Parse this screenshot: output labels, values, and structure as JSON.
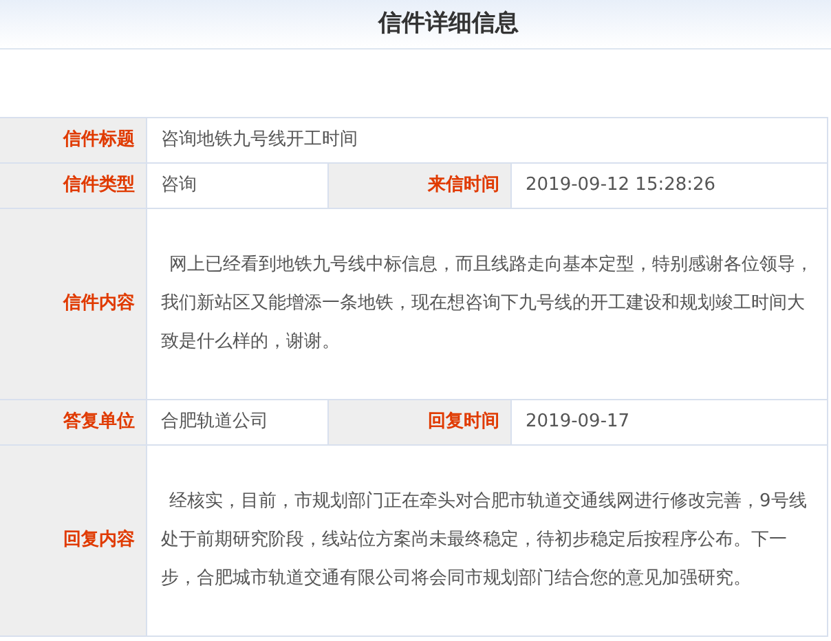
{
  "header": {
    "title": "信件详细信息"
  },
  "rows": [
    {
      "kind": "single",
      "label": "信件标题",
      "value": "咨询地铁九号线开工时间"
    },
    {
      "kind": "pair",
      "label": "信件类型",
      "value": "咨询",
      "label_2": "来信时间",
      "value_2": "2019-09-12 15:28:26"
    },
    {
      "kind": "long",
      "label": "信件内容",
      "value": "网上已经看到地铁九号线中标信息，而且线路走向基本定型，特别感谢各位领导，我们新站区又能增添一条地铁，现在想咨询下九号线的开工建设和规划竣工时间大致是什么样的，谢谢。"
    },
    {
      "kind": "pair",
      "label": "答复单位",
      "value": "合肥轨道公司",
      "label_2": "回复时间",
      "value_2": "2019-09-17"
    },
    {
      "kind": "long",
      "label": "回复内容",
      "value": "经核实，目前，市规划部门正在牵头对合肥市轨道交通线网进行修改完善，9号线处于前期研究阶段，线站位方案尚未最终稳定，待初步稳定后按程序公布。下一步，合肥城市轨道交通有限公司将会同市规划部门结合您的意见加强研究。"
    }
  ]
}
